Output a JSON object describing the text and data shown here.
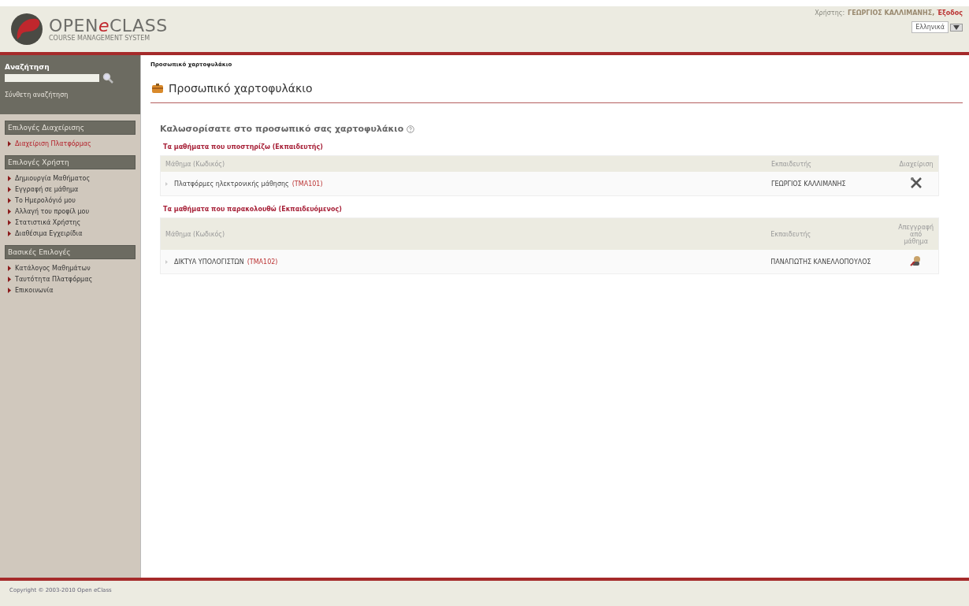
{
  "header": {
    "logo_title": "OPEN",
    "logo_title_accent": "e",
    "logo_title_end": "CLASS",
    "logo_subtitle": "COURSE MANAGEMENT SYSTEM",
    "user_label": "Χρήστης:",
    "user_name": "ΓΕΩΡΓΙΟΣ ΚΑΛΛΙΜΑΝΗΣ,",
    "logout": "Έξοδος",
    "language": "Ελληνικά"
  },
  "sidebar": {
    "search_title": "Αναζήτηση",
    "advanced_search": "Σύνθετη αναζήτηση",
    "sections": [
      {
        "title": "Επιλογές Διαχείρισης",
        "items": [
          {
            "label": "Διαχείριση Πλατφόρμας",
            "highlighted": true
          }
        ]
      },
      {
        "title": "Επιλογές Χρήστη",
        "items": [
          {
            "label": "Δημιουργία Μαθήματος",
            "highlighted": false
          },
          {
            "label": "Εγγραφή σε μάθημα",
            "highlighted": false
          },
          {
            "label": "Το Ημερολόγιό μου",
            "highlighted": false
          },
          {
            "label": "Αλλαγή του προφίλ μου",
            "highlighted": false
          },
          {
            "label": "Στατιστικά Χρήστης",
            "highlighted": false
          },
          {
            "label": "Διαθέσιμα Εγχειρίδια",
            "highlighted": false
          }
        ]
      },
      {
        "title": "Βασικές Επιλογές",
        "items": [
          {
            "label": "Κατάλογος Μαθημάτων",
            "highlighted": false
          },
          {
            "label": "Ταυτότητα Πλατφόρμας",
            "highlighted": false
          },
          {
            "label": "Επικοινωνία",
            "highlighted": false
          }
        ]
      }
    ]
  },
  "breadcrumb": "Προσωπικό χαρτοφυλάκιο",
  "page_title": "Προσωπικό χαρτοφυλάκιο",
  "welcome": "Καλωσορίσατε στο προσωπικό σας χαρτοφυλάκιο",
  "tables": [
    {
      "heading": "Τα μαθήματα που υποστηρίζω (Εκπαιδευτής)",
      "columns": [
        "Μάθημα (Κωδικός)",
        "Εκπαιδευτής",
        "Διαχείριση"
      ],
      "kind": "manage",
      "rows": [
        {
          "course": "Πλατφόρμες ηλεκτρονικής μάθησης",
          "code": "(ΤΜΑ101)",
          "teacher": "ΓΕΩΡΓΙΟΣ ΚΑΛΛΙΜΑΝΗΣ"
        }
      ]
    },
    {
      "heading": "Τα μαθήματα που παρακολουθώ (Εκπαιδευόμενος)",
      "columns": [
        "Μάθημα (Κωδικός)",
        "Εκπαιδευτής",
        "Απεγγραφή από μάθημα"
      ],
      "kind": "unregister",
      "rows": [
        {
          "course": "ΔΙΚΤΥΑ ΥΠΟΛΟΓΙΣΤΩΝ",
          "code": "(ΤΜΑ102)",
          "teacher": "ΠΑΝΑΓΙΩΤΗΣ ΚΑΝΕΛΛΟΠΟΥΛΟΣ"
        }
      ]
    }
  ],
  "footer": "Copyright © 2003-2010 Open eClass"
}
